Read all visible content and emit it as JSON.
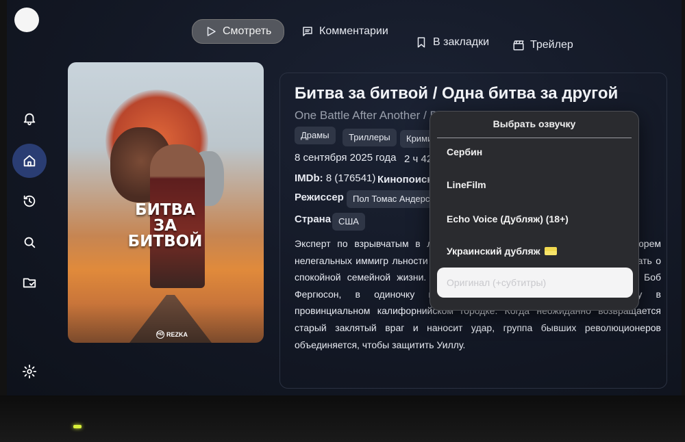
{
  "tabs": [
    {
      "label": "Смотреть",
      "icon": "play-icon"
    },
    {
      "label": "Комментарии",
      "icon": "comment-icon"
    },
    {
      "label": "В закладки",
      "icon": "bookmark-icon"
    },
    {
      "label": "Трейлер",
      "icon": "clapper-icon"
    }
  ],
  "sidebar": {
    "items": [
      {
        "name": "notifications",
        "icon": "bell-icon"
      },
      {
        "name": "home",
        "icon": "home-icon",
        "active": true
      },
      {
        "name": "history",
        "icon": "history-icon"
      },
      {
        "name": "search",
        "icon": "search-icon"
      },
      {
        "name": "favorites",
        "icon": "folder-check-icon"
      },
      {
        "name": "settings",
        "icon": "gear-icon"
      }
    ]
  },
  "poster": {
    "title_line1": "БИТВА",
    "title_line2": "ЗА",
    "title_line3": "БИТВОЙ",
    "logo": "REZKA",
    "logo_badge": "HD"
  },
  "movie": {
    "title": "Битва за битвой / Одна битва за другой",
    "subtitle": "One Battle After Another / B",
    "genres": [
      "Драмы",
      "Триллеры",
      "Крими"
    ],
    "date": "8 сентября 2025 года",
    "duration": "2 ч 42",
    "imdb_label": "IMDb:",
    "imdb_value": "8 (176541)",
    "kinopoisk_label": "Кинопоиск:",
    "director_label": "Режиссер",
    "director": "Пол Томас Андерсо",
    "country_label": "Страна",
    "country": "США",
    "description": "Эксперт по взрывчатым в                                                              левой террористической группиро                                                              ает из тюрем нелегальных иммигр                                                              льности мужчина заводит отношени                                                              но не может думать о спокойной семейной жизни. Много лет спустя Пэт, сменивший имя на Боб Фергюсон, в одиночку воспитывает дочь-старшеклассницу Уиллу в провинциальном калифорнийском городке. Когда неожиданно возвращается старый заклятый враг и наносит удар, группа бывших революционеров объединяется, чтобы защитить Уиллу."
  },
  "dub_popup": {
    "title": "Выбрать озвучку",
    "items": [
      {
        "label": "Сербин"
      },
      {
        "label": "LineFilm"
      },
      {
        "label": "Echo Voice (Дубляж) (18+)"
      },
      {
        "label": "Украинский дубляж"
      },
      {
        "label": "Оригинал (+субтитры)",
        "selected": true
      }
    ]
  }
}
